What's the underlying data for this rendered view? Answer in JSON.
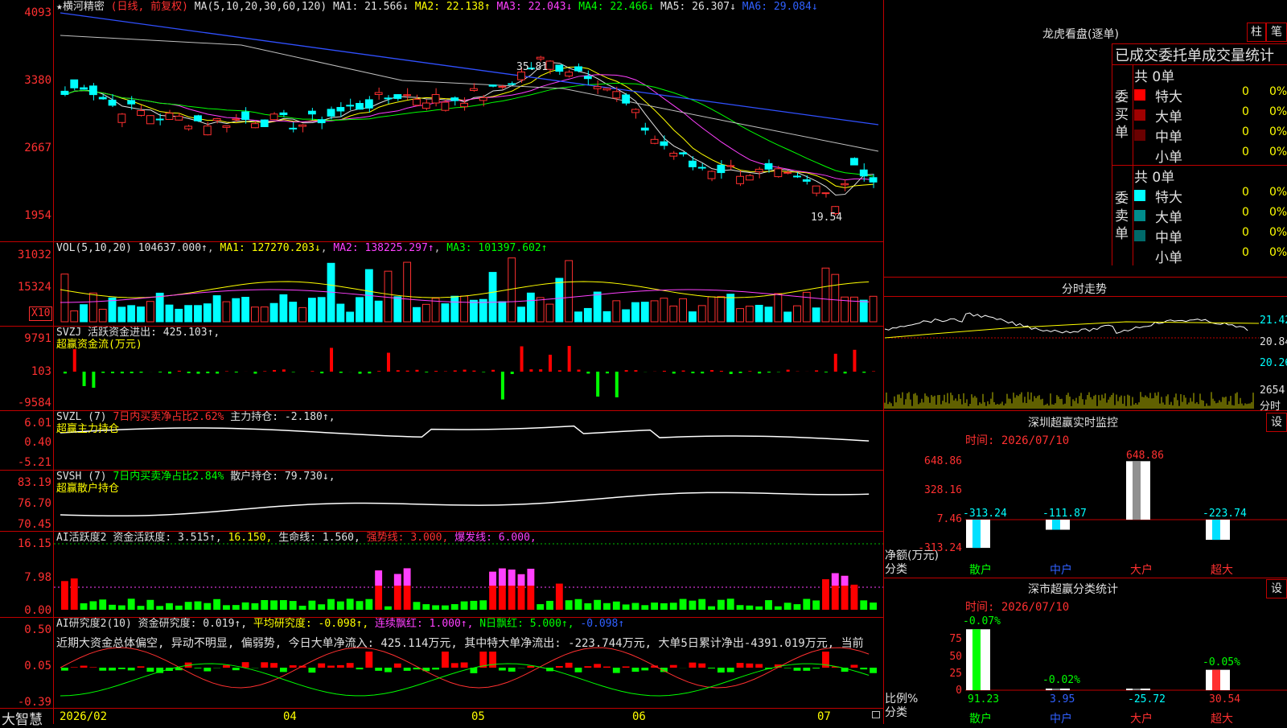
{
  "main_chart": {
    "stock_name": "★横河精密",
    "period_tag": "(日线, 前复权)",
    "ma_legend": "MA(5,10,20,30,60,120)",
    "ma_items": [
      {
        "label": "MA1: 21.566↓",
        "color": "#e0e0e0"
      },
      {
        "label": "MA2: 22.138↑",
        "color": "#ffff00"
      },
      {
        "label": "MA3: 22.043↓",
        "color": "#ff40ff"
      },
      {
        "label": "MA4: 22.466↓",
        "color": "#00ff00"
      },
      {
        "label": "MA5: 26.307↓",
        "color": "#e0e0e0"
      },
      {
        "label": "MA6: 29.084↓",
        "color": "#3060ff"
      }
    ],
    "y_ticks": [
      "4093",
      "3380",
      "2667",
      "1954"
    ],
    "high_label": "35.81",
    "low_label": "19.54"
  },
  "volume_panel": {
    "header": "VOL(5,10,20)",
    "value": "104637.000↑",
    "ma1": "MA1: 127270.203↓",
    "ma2": "MA2: 138225.297↑",
    "ma3": "MA3: 101397.602↑",
    "y_ticks": [
      "31032",
      "15324"
    ],
    "unit": "X10"
  },
  "svzj_panel": {
    "header": "SVZJ",
    "label": "活跃资金进出: 425.103↑,",
    "subtitle": "超赢资金流(万元)",
    "y_ticks": [
      "9791",
      "103",
      "-9584"
    ]
  },
  "svzl_panel": {
    "header": "SVZL (7)",
    "ratio": "7日内买卖净占比2.62%",
    "label": "主力持仓: -2.180↑,",
    "subtitle": "超赢主力持仓",
    "y_ticks": [
      "6.01",
      "0.40",
      "-5.21"
    ]
  },
  "svsh_panel": {
    "header": "SVSH (7)",
    "ratio": "7日内买卖净占比2.84%",
    "label": "散户持仓: 79.730↓,",
    "subtitle": "超赢散户持仓",
    "y_ticks": [
      "83.19",
      "76.70",
      "70.45"
    ]
  },
  "ai_active_panel": {
    "header": "AI活跃度2",
    "label1": "资金活跃度: 3.515↑,",
    "label2": "16.150,",
    "label3": "生命线: 1.560,",
    "label4": "强势线: 3.000,",
    "label5": "爆发线: 6.000,",
    "y_ticks": [
      "16.15",
      "7.98",
      "0.00"
    ]
  },
  "ai_research_panel": {
    "header": "AI研究度2(10)",
    "label1": "资金研究度: 0.019↑,",
    "label2": "平均研究度: -0.098↑,",
    "label3": "连续飘红: 1.000↑,",
    "label4": "N日飘红: 5.000↑,",
    "label5": "-0.098↑",
    "commentary": "近期大资金总体偏空, 异动不明显, 偏弱势, 今日大单净流入: 425.114万元, 其中特大单净流出: -223.744万元, 大单5日累计净出-4391.019万元, 当前",
    "y_ticks": [
      "0.50",
      "0.05",
      "-0.39"
    ]
  },
  "bottom_bar": {
    "brand": "大智慧",
    "dates": [
      "2026/02",
      "04",
      "05",
      "06",
      "07"
    ]
  },
  "dragon_tiger": {
    "title": "龙虎看盘(逐单)",
    "btn_bar": "柱",
    "btn_pen": "笔",
    "subtitle": "已成交委托单成交量统计",
    "buy_label": "委买单",
    "sell_label": "委卖单",
    "buy_total": "共 0单",
    "sell_total": "共 0单",
    "buy_rows": [
      {
        "name": "特大",
        "count": "0",
        "pct": "0%",
        "color": "#ff0000"
      },
      {
        "name": "大单",
        "count": "0",
        "pct": "0%",
        "color": "#a00000"
      },
      {
        "name": "中单",
        "count": "0",
        "pct": "0%",
        "color": "#6a0000"
      },
      {
        "name": "小单",
        "count": "0",
        "pct": "0%",
        "color": ""
      }
    ],
    "sell_rows": [
      {
        "name": "特大",
        "count": "0",
        "pct": "0%",
        "color": "#00ffff"
      },
      {
        "name": "大单",
        "count": "0",
        "pct": "0%",
        "color": "#008c8c"
      },
      {
        "name": "中单",
        "count": "0",
        "pct": "0%",
        "color": "#006a6a"
      },
      {
        "name": "小单",
        "count": "0",
        "pct": "0%",
        "color": ""
      }
    ]
  },
  "intraday": {
    "title": "分时走势",
    "price_ticks": [
      "21.42",
      "20.84",
      "20.26"
    ],
    "volume_tick": "2654",
    "volume_label": "分时"
  },
  "sz_monitor": {
    "title": "深圳超赢实时监控",
    "settings_btn": "设",
    "time": "时间: 2026/07/10",
    "y_ticks": [
      "648.86",
      "328.16",
      "7.46",
      "-313.24"
    ],
    "y_axis_label": "净额(万元)",
    "x_axis_label": "分类",
    "chart_data": {
      "type": "bar",
      "categories": [
        "散户",
        "中户",
        "大户",
        "超大"
      ],
      "values": [
        -313.24,
        -111.87,
        648.86,
        -223.74
      ],
      "labels": [
        "-313.24",
        "-111.87",
        "648.86",
        "-223.74"
      ],
      "ylim": [
        -313.24,
        648.86
      ]
    }
  },
  "sz_class": {
    "title": "深市超赢分类统计",
    "settings_btn": "设",
    "time": "时间: 2026/07/10",
    "y_ticks": [
      "75",
      "50",
      "25",
      "0"
    ],
    "y_axis_label": "比例%",
    "x_axis_label": "分类",
    "chart_data": {
      "type": "bar",
      "categories": [
        "散户",
        "中户",
        "大户",
        "超大"
      ],
      "values": [
        91.23,
        3.95,
        -25.72,
        30.54
      ],
      "value_labels": [
        "91.23",
        "3.95",
        "-25.72",
        "30.54"
      ],
      "change_labels": [
        "-0.07%",
        "-0.02%",
        "",
        "-0.05%"
      ],
      "ylim": [
        0,
        100
      ]
    }
  }
}
